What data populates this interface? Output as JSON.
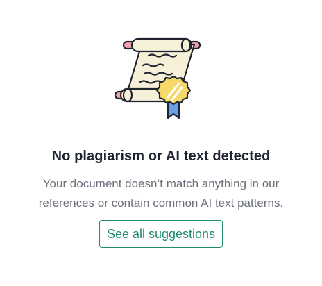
{
  "empty_state": {
    "title": "No plagiarism or AI text detected",
    "message_line1": "Your document doesn’t match anything in our",
    "message_line2": "references or contain common AI text patterns.",
    "cta_label": "See all suggestions",
    "illustration_icon": "certificate-scroll-icon",
    "colors": {
      "title": "#1f2430",
      "message": "#6b6f7b",
      "accent": "#1f8a70",
      "scroll_fill": "#f7f0d8",
      "roller_end": "#f0a5ae",
      "seal": "#f7d86a",
      "ribbon": "#6b9ee8"
    }
  }
}
